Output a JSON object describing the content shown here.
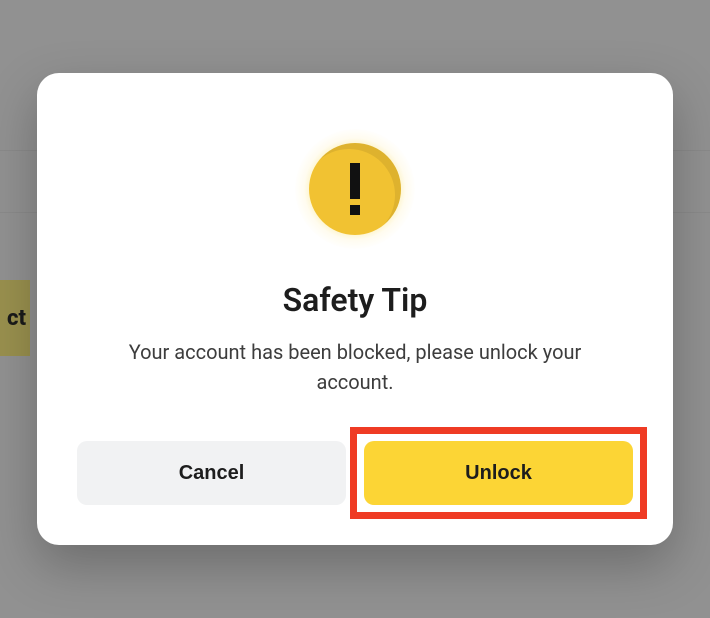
{
  "background": {
    "peek_button_text": "ct"
  },
  "modal": {
    "icon_name": "warning-icon",
    "title": "Safety Tip",
    "message": "Your account has been blocked, please unlock your account.",
    "cancel_label": "Cancel",
    "confirm_label": "Unlock"
  },
  "colors": {
    "accent": "#FCD535",
    "highlight": "#ef3b24",
    "neutral_button": "#f1f2f3"
  }
}
